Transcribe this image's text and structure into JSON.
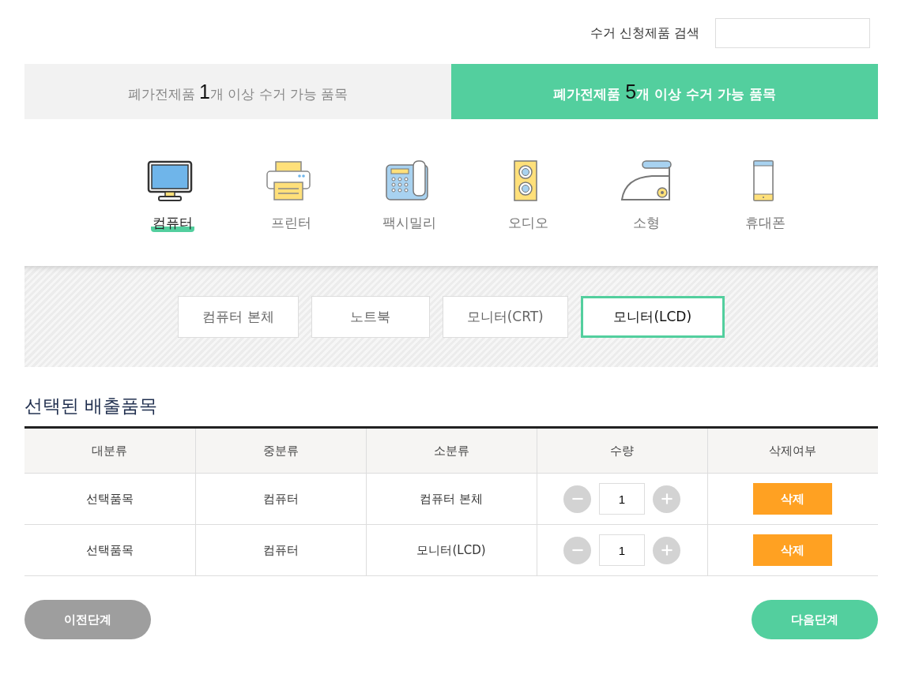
{
  "search": {
    "label": "수거 신청제품 검색"
  },
  "tabs": [
    {
      "before": "폐가전제품 ",
      "count": "1",
      "after": "개 이상 수거 가능 품목",
      "selected": false
    },
    {
      "before": "폐가전제품 ",
      "count": "5",
      "after": "개 이상 수거 가능 품목",
      "selected": true
    }
  ],
  "categories": [
    {
      "kind": "computer",
      "label": "컴퓨터",
      "selected": true
    },
    {
      "kind": "printer",
      "label": "프린터",
      "selected": false
    },
    {
      "kind": "fax",
      "label": "팩시밀리",
      "selected": false
    },
    {
      "kind": "audio",
      "label": "오디오",
      "selected": false
    },
    {
      "kind": "small",
      "label": "소형",
      "selected": false
    },
    {
      "kind": "phone",
      "label": "휴대폰",
      "selected": false
    }
  ],
  "subcategories": [
    {
      "label": "컴퓨터 본체",
      "selected": false
    },
    {
      "label": "노트북",
      "selected": false
    },
    {
      "label": "모니터(CRT)",
      "selected": false
    },
    {
      "label": "모니터(LCD)",
      "selected": true
    }
  ],
  "selected_title": "선택된 배출품목",
  "table": {
    "columns": [
      "대분류",
      "중분류",
      "소분류",
      "수량",
      "삭제여부"
    ],
    "rows": [
      {
        "major": "선택품목",
        "middle": "컴퓨터",
        "minor": "컴퓨터 본체",
        "quantity": "1",
        "delete": "삭제"
      },
      {
        "major": "선택품목",
        "middle": "컴퓨터",
        "minor": "모니터(LCD)",
        "quantity": "1",
        "delete": "삭제"
      }
    ]
  },
  "buttons": {
    "prev": "이전단계",
    "next": "다음단계"
  }
}
